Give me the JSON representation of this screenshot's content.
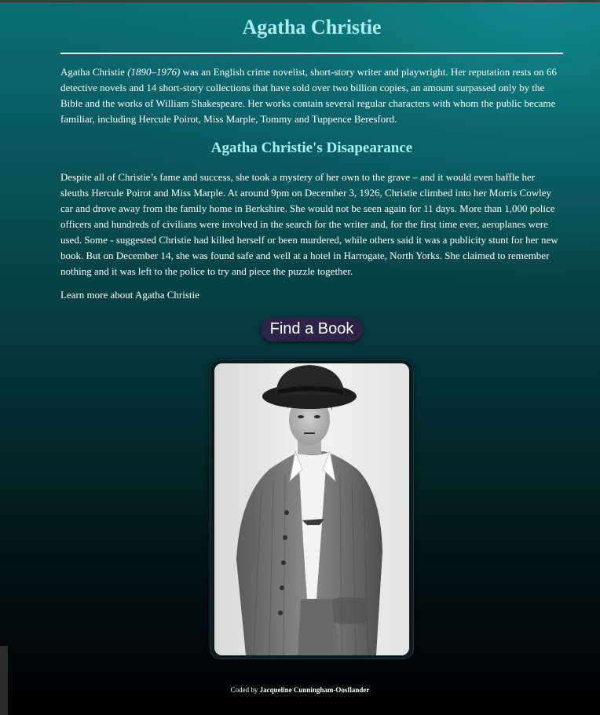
{
  "page": {
    "title": "Agatha Christie"
  },
  "intro": {
    "name": "Agatha Christie",
    "years": "(1890–1976)",
    "text": "was an English crime novelist, short-story writer and playwright. Her reputation rests on 66 detective novels and 14 short-story collections that have sold over two billion copies, an amount surpassed only by the Bible and the works of William Shakespeare. Her works contain several regular characters with whom the public became familiar, including Hercule Poirot, Miss Marple, Tommy and Tuppence Beresford."
  },
  "disappearance": {
    "heading": "Agatha Christie's Disapearance",
    "text": "Despite all of Christie’s fame and success, she took a mystery of her own to the grave – and it would even baffle her sleuths Hercule Poirot and Miss Marple. At around 9pm on December 3, 1926, Christie climbed into her Morris Cowley car and drove away from the family home in Berkshire. She would not be seen again for 11 days. More than 1,000 police officers and hundreds of civilians were involved in the search for the writer and, for the first time ever, aeroplanes were used. Some - suggested Christie had killed herself or been murdered, while others said it was a publicity stunt for her new book. But on December 14, she was found safe and well at a hotel in Harrogate, North Yorks. She claimed to remember nothing and it was left to the police to try and piece the puzzle together."
  },
  "links": {
    "learn_more": "Learn more about Agatha Christie"
  },
  "buttons": {
    "find_book": "Find a Book"
  },
  "footer": {
    "prefix": "Coded by",
    "author": "Jacqueline Cunningham-Oosflander"
  },
  "colors": {
    "heading": "#a6eef0",
    "button_bg": "#2c2447",
    "bg_top": "#0b6f73",
    "bg_bottom": "#000000"
  }
}
